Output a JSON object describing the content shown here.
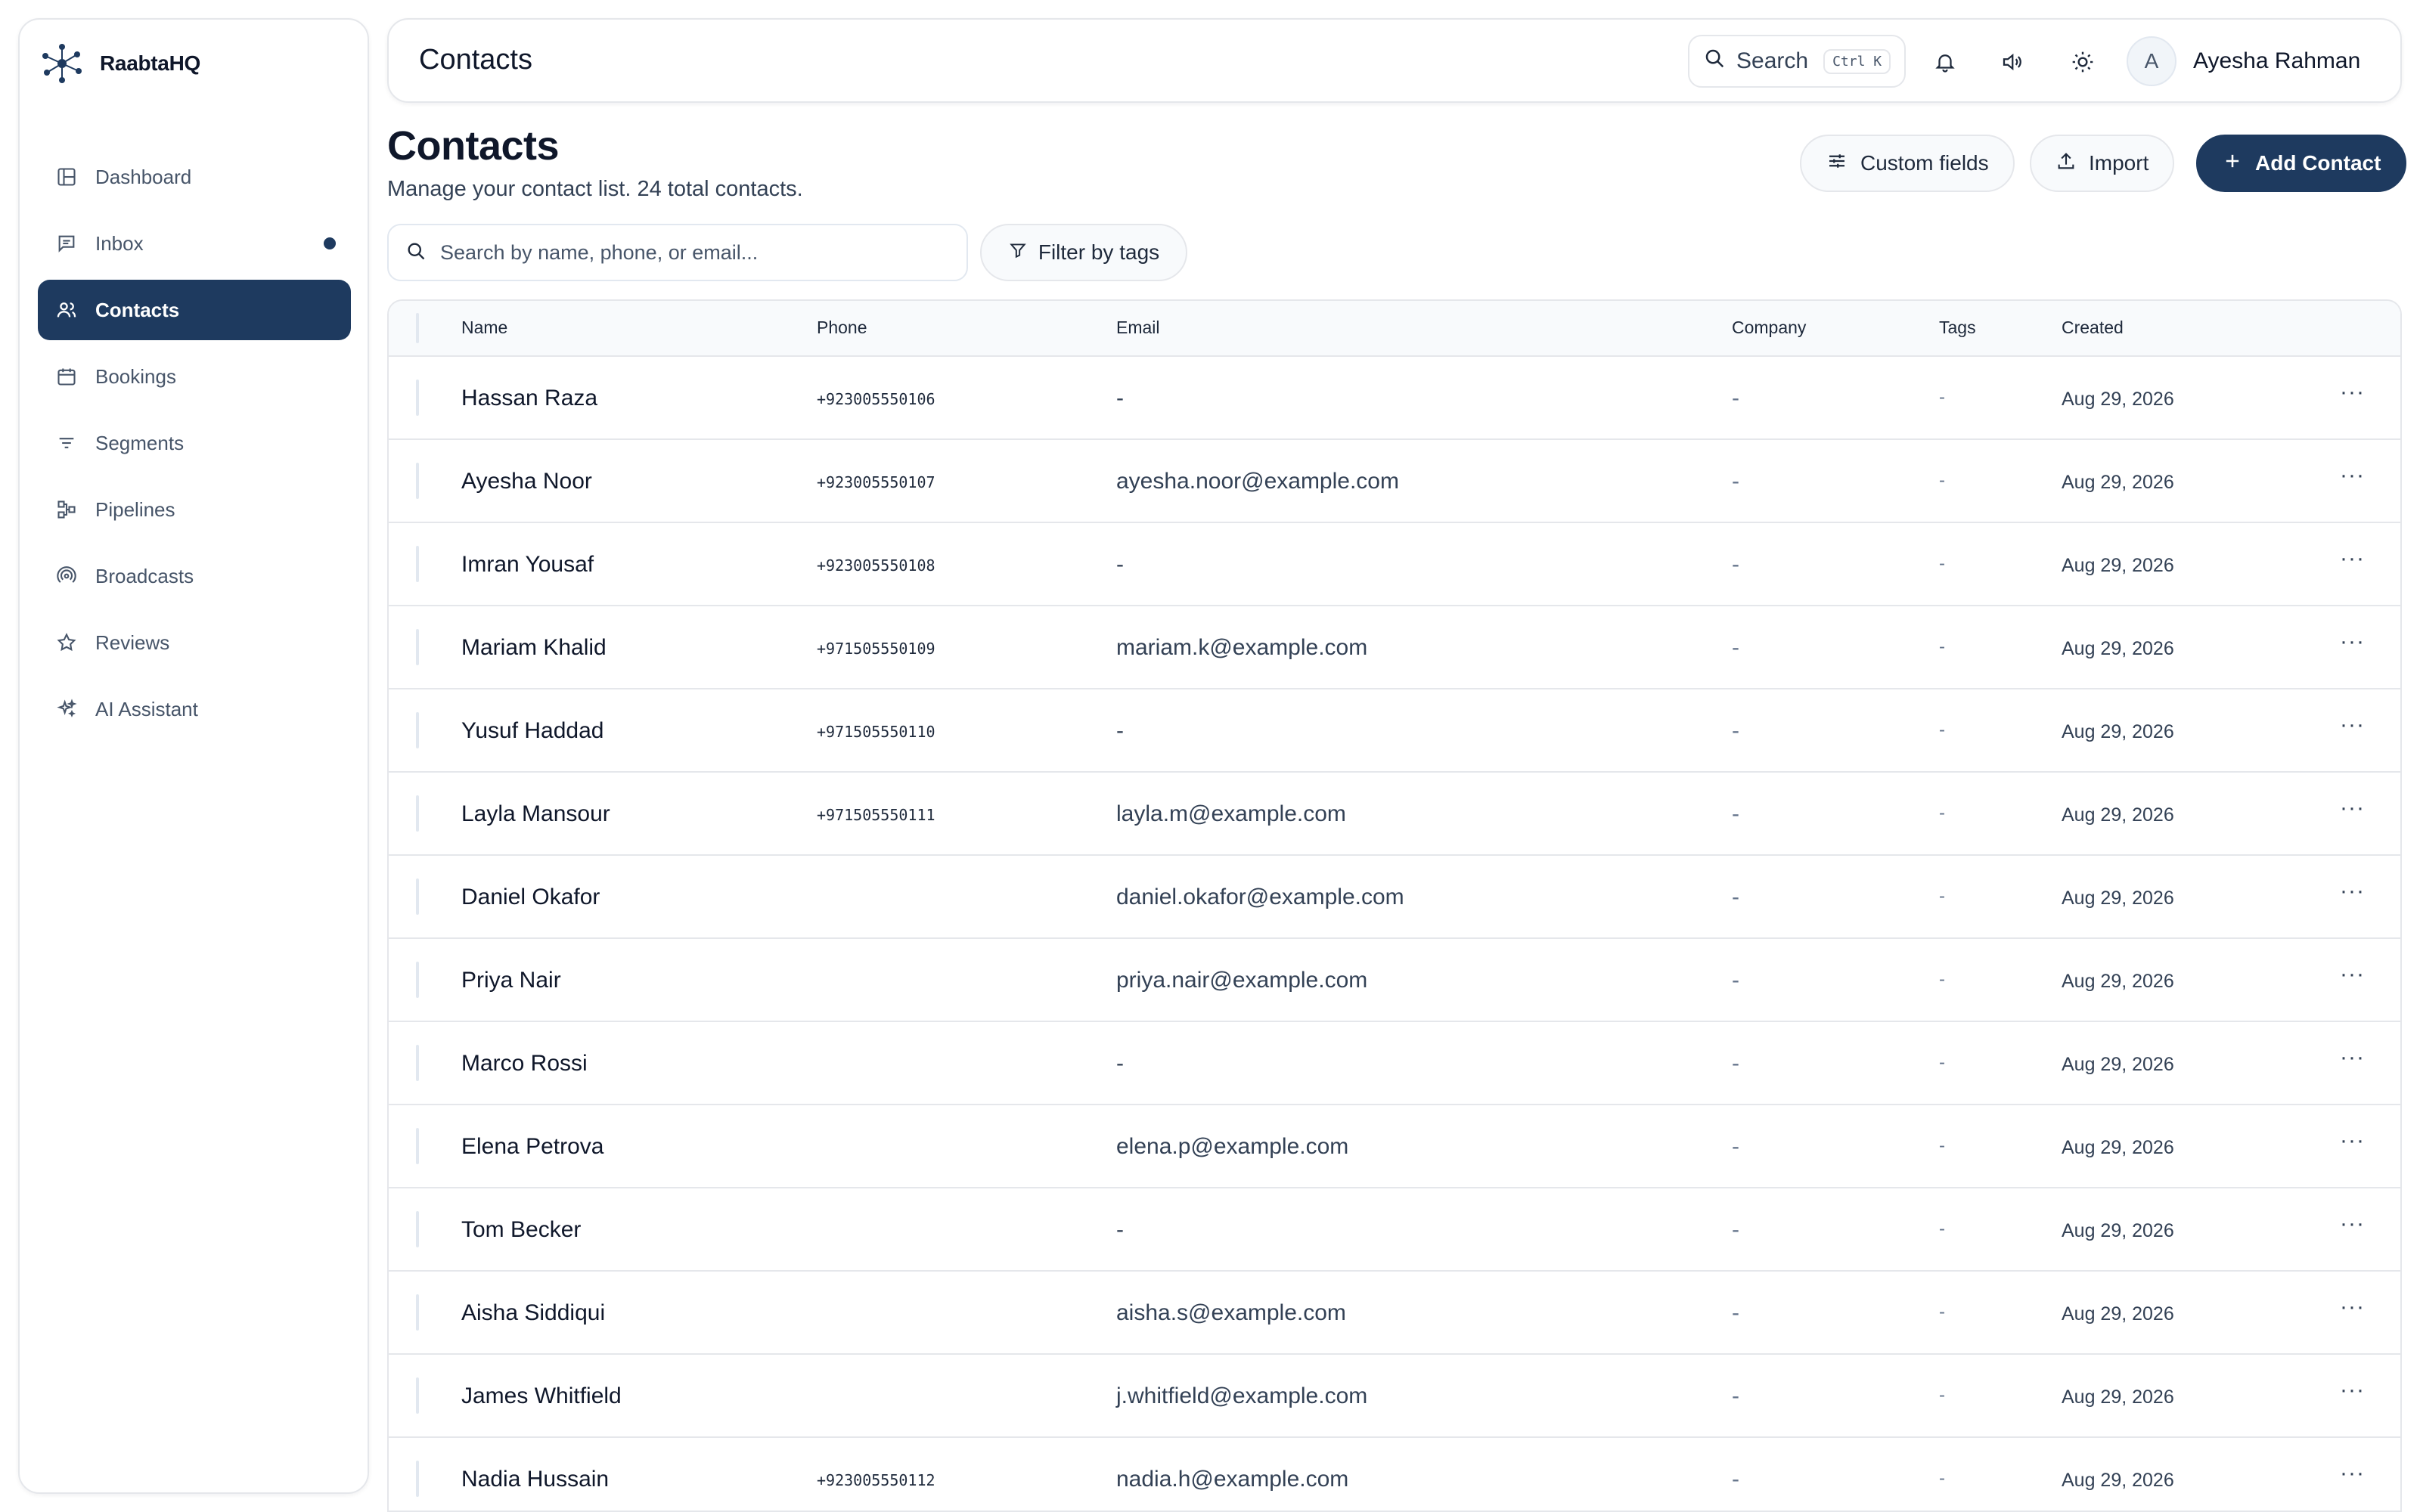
{
  "brand": {
    "name": "RaabtaHQ",
    "logo_icon": "network-logo-icon"
  },
  "sidebar": {
    "items": [
      {
        "label": "Dashboard",
        "icon": "layout-icon",
        "active": false
      },
      {
        "label": "Inbox",
        "icon": "message-icon",
        "active": false,
        "unread_dot": true
      },
      {
        "label": "Contacts",
        "icon": "users-icon",
        "active": true
      },
      {
        "label": "Bookings",
        "icon": "calendar-icon",
        "active": false
      },
      {
        "label": "Segments",
        "icon": "filter-lines-icon",
        "active": false
      },
      {
        "label": "Pipelines",
        "icon": "pipeline-icon",
        "active": false
      },
      {
        "label": "Broadcasts",
        "icon": "broadcast-icon",
        "active": false
      },
      {
        "label": "Reviews",
        "icon": "star-icon",
        "active": false
      },
      {
        "label": "AI Assistant",
        "icon": "sparkles-icon",
        "active": false
      }
    ]
  },
  "header": {
    "title": "Contacts",
    "search_label": "Search",
    "search_shortcut": "Ctrl K",
    "user_initial": "A",
    "user_name": "Ayesha Rahman"
  },
  "page": {
    "title": "Contacts",
    "subtitle": "Manage your contact list. 24 total contacts.",
    "custom_fields_label": "Custom fields",
    "import_label": "Import",
    "add_contact_label": "Add Contact",
    "search_placeholder": "Search by name, phone, or email...",
    "filter_label": "Filter by tags"
  },
  "table": {
    "columns": [
      "Name",
      "Phone",
      "Email",
      "Company",
      "Tags",
      "Created"
    ],
    "rows": [
      {
        "name": "Hassan Raza",
        "phone": "+923005550106",
        "email": "-",
        "company": "-",
        "tags": "-",
        "created": "Aug 29, 2026"
      },
      {
        "name": "Ayesha Noor",
        "phone": "+923005550107",
        "email": "ayesha.noor@example.com",
        "company": "-",
        "tags": "-",
        "created": "Aug 29, 2026"
      },
      {
        "name": "Imran Yousaf",
        "phone": "+923005550108",
        "email": "-",
        "company": "-",
        "tags": "-",
        "created": "Aug 29, 2026"
      },
      {
        "name": "Mariam Khalid",
        "phone": "+971505550109",
        "email": "mariam.k@example.com",
        "company": "-",
        "tags": "-",
        "created": "Aug 29, 2026"
      },
      {
        "name": "Yusuf Haddad",
        "phone": "+971505550110",
        "email": "-",
        "company": "-",
        "tags": "-",
        "created": "Aug 29, 2026"
      },
      {
        "name": "Layla Mansour",
        "phone": "+971505550111",
        "email": "layla.m@example.com",
        "company": "-",
        "tags": "-",
        "created": "Aug 29, 2026"
      },
      {
        "name": "Daniel Okafor",
        "phone": "",
        "email": "daniel.okafor@example.com",
        "company": "-",
        "tags": "-",
        "created": "Aug 29, 2026"
      },
      {
        "name": "Priya Nair",
        "phone": "",
        "email": "priya.nair@example.com",
        "company": "-",
        "tags": "-",
        "created": "Aug 29, 2026"
      },
      {
        "name": "Marco Rossi",
        "phone": "",
        "email": "-",
        "company": "-",
        "tags": "-",
        "created": "Aug 29, 2026"
      },
      {
        "name": "Elena Petrova",
        "phone": "",
        "email": "elena.p@example.com",
        "company": "-",
        "tags": "-",
        "created": "Aug 29, 2026"
      },
      {
        "name": "Tom Becker",
        "phone": "",
        "email": "-",
        "company": "-",
        "tags": "-",
        "created": "Aug 29, 2026"
      },
      {
        "name": "Aisha Siddiqui",
        "phone": "",
        "email": "aisha.s@example.com",
        "company": "-",
        "tags": "-",
        "created": "Aug 29, 2026"
      },
      {
        "name": "James Whitfield",
        "phone": "",
        "email": "j.whitfield@example.com",
        "company": "-",
        "tags": "-",
        "created": "Aug 29, 2026"
      },
      {
        "name": "Nadia Hussain",
        "phone": "+923005550112",
        "email": "nadia.h@example.com",
        "company": "-",
        "tags": "-",
        "created": "Aug 29, 2026"
      }
    ],
    "row_menu_glyph": "···"
  },
  "colors": {
    "primary": "#1e3a5f",
    "border": "#e5e7eb",
    "muted": "#64748b"
  }
}
